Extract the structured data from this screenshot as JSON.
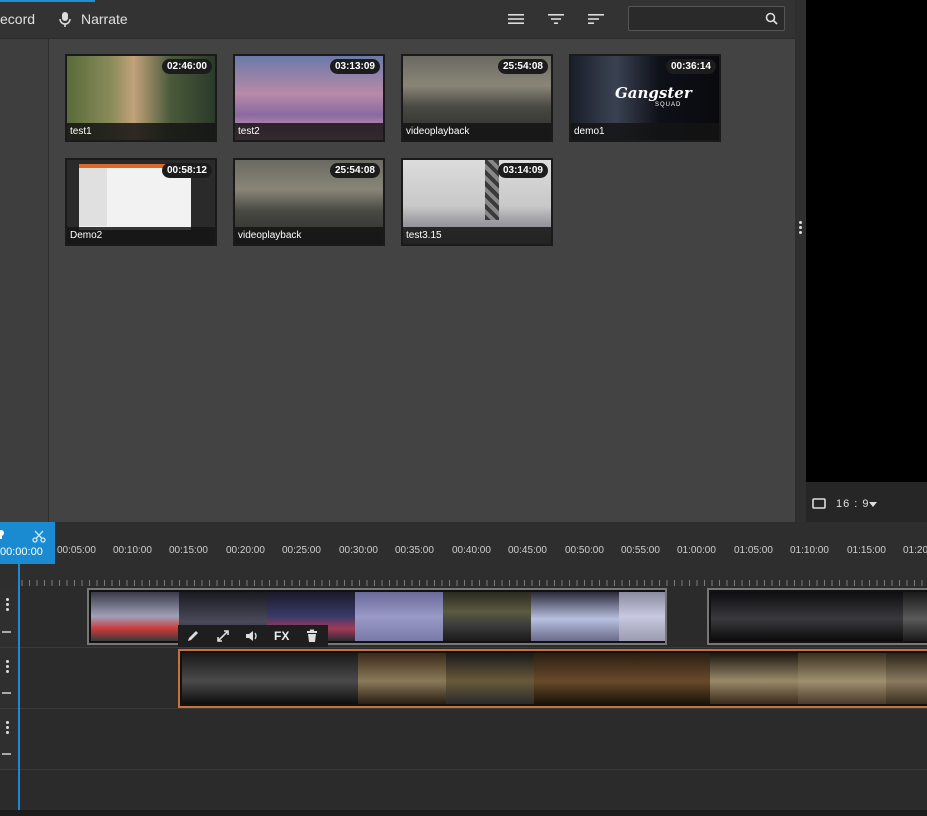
{
  "toolbar": {
    "record_label": "ecord",
    "narrate_label": "Narrate",
    "search": {
      "value": "",
      "placeholder": ""
    }
  },
  "media": {
    "items": [
      {
        "title": "test1",
        "duration": "02:46:00"
      },
      {
        "title": "test2",
        "duration": "03:13:09"
      },
      {
        "title": "videoplayback",
        "duration": "25:54:08"
      },
      {
        "title": "demo1",
        "duration": "00:36:14",
        "overlay_text": "Gangster",
        "overlay_sub": "SQUAD"
      },
      {
        "title": "Demo2",
        "duration": "00:58:12"
      },
      {
        "title": "videoplayback",
        "duration": "25:54:08"
      },
      {
        "title": "test3.15",
        "duration": "03:14:09"
      }
    ]
  },
  "preview": {
    "aspect_label": "16 : 9"
  },
  "timeline": {
    "current_time": "00:00:00",
    "ruler": [
      "00:05:00",
      "00:10:00",
      "00:15:00",
      "00:20:00",
      "00:25:00",
      "00:30:00",
      "00:35:00",
      "00:40:00",
      "00:45:00",
      "00:50:00",
      "00:55:00",
      "01:00:00",
      "01:05:00",
      "01:10:00",
      "01:15:00",
      "01:20"
    ],
    "clip_tools": {
      "fx_label": "FX"
    }
  },
  "colors": {
    "accent": "#1a8bd0",
    "selected_clip": "#c8713a"
  }
}
